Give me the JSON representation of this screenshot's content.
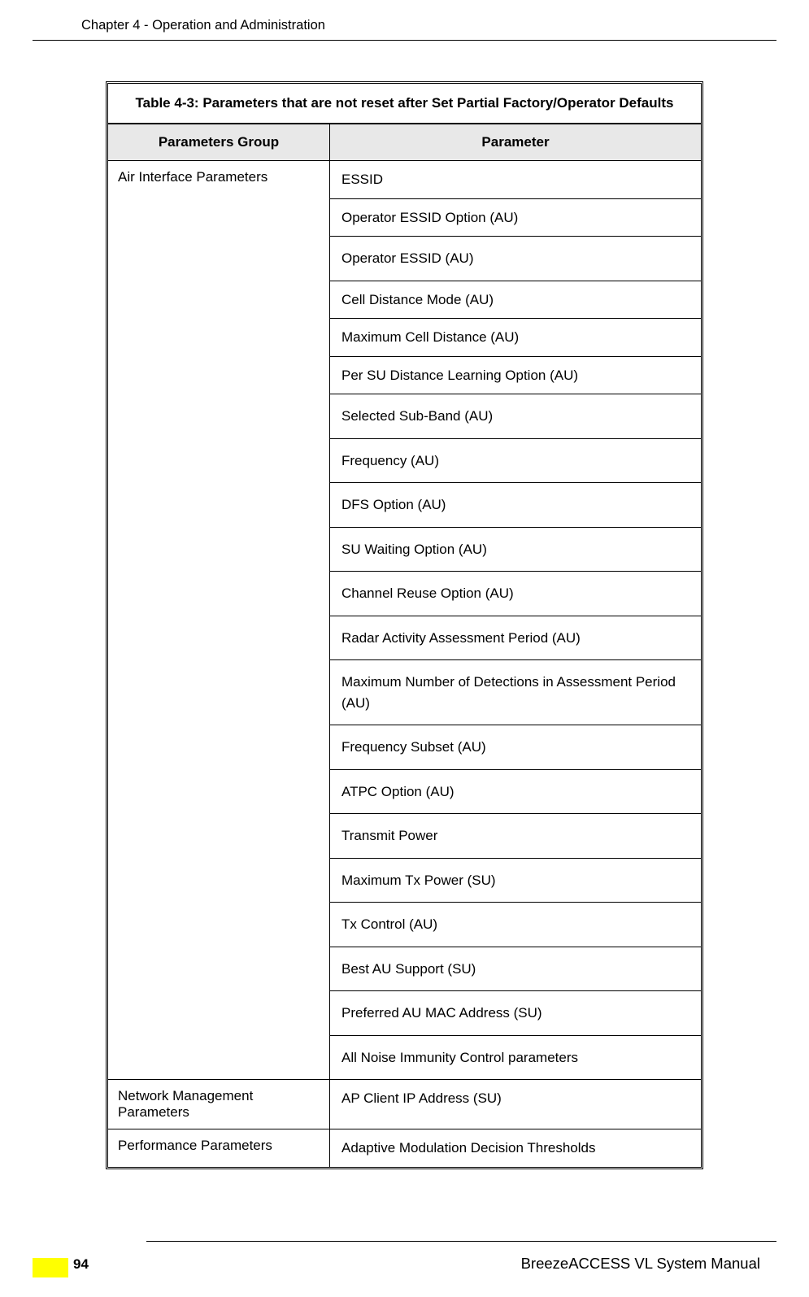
{
  "header": {
    "chapter": "Chapter 4 - Operation and Administration"
  },
  "table": {
    "title": "Table 4-3: Parameters that are not reset after Set Partial Factory/Operator Defaults",
    "columns": {
      "group": "Parameters Group",
      "param": "Parameter"
    },
    "rows": [
      {
        "group": "Air Interface Parameters",
        "params": [
          "ESSID",
          "Operator ESSID Option (AU)",
          "Operator ESSID (AU)",
          "Cell Distance Mode (AU)",
          "Maximum Cell Distance (AU)",
          "Per SU Distance Learning Option (AU)",
          "Selected Sub-Band (AU)",
          "Frequency (AU)",
          "DFS Option (AU)",
          "SU Waiting Option (AU)",
          "Channel Reuse Option (AU)",
          "Radar Activity Assessment Period (AU)",
          "Maximum Number of Detections in Assessment Period (AU)",
          "Frequency Subset (AU)",
          "ATPC Option (AU)",
          "Transmit Power",
          "Maximum Tx Power (SU)",
          "Tx Control (AU)",
          "Best AU Support (SU)",
          "Preferred AU MAC Address (SU)",
          "All Noise Immunity Control parameters"
        ]
      },
      {
        "group": "Network Management Parameters",
        "params": [
          "AP Client IP Address (SU)"
        ]
      },
      {
        "group": "Performance Parameters",
        "params": [
          "Adaptive Modulation Decision Thresholds"
        ]
      }
    ]
  },
  "footer": {
    "manual": "BreezeACCESS VL System Manual",
    "page": "94"
  }
}
